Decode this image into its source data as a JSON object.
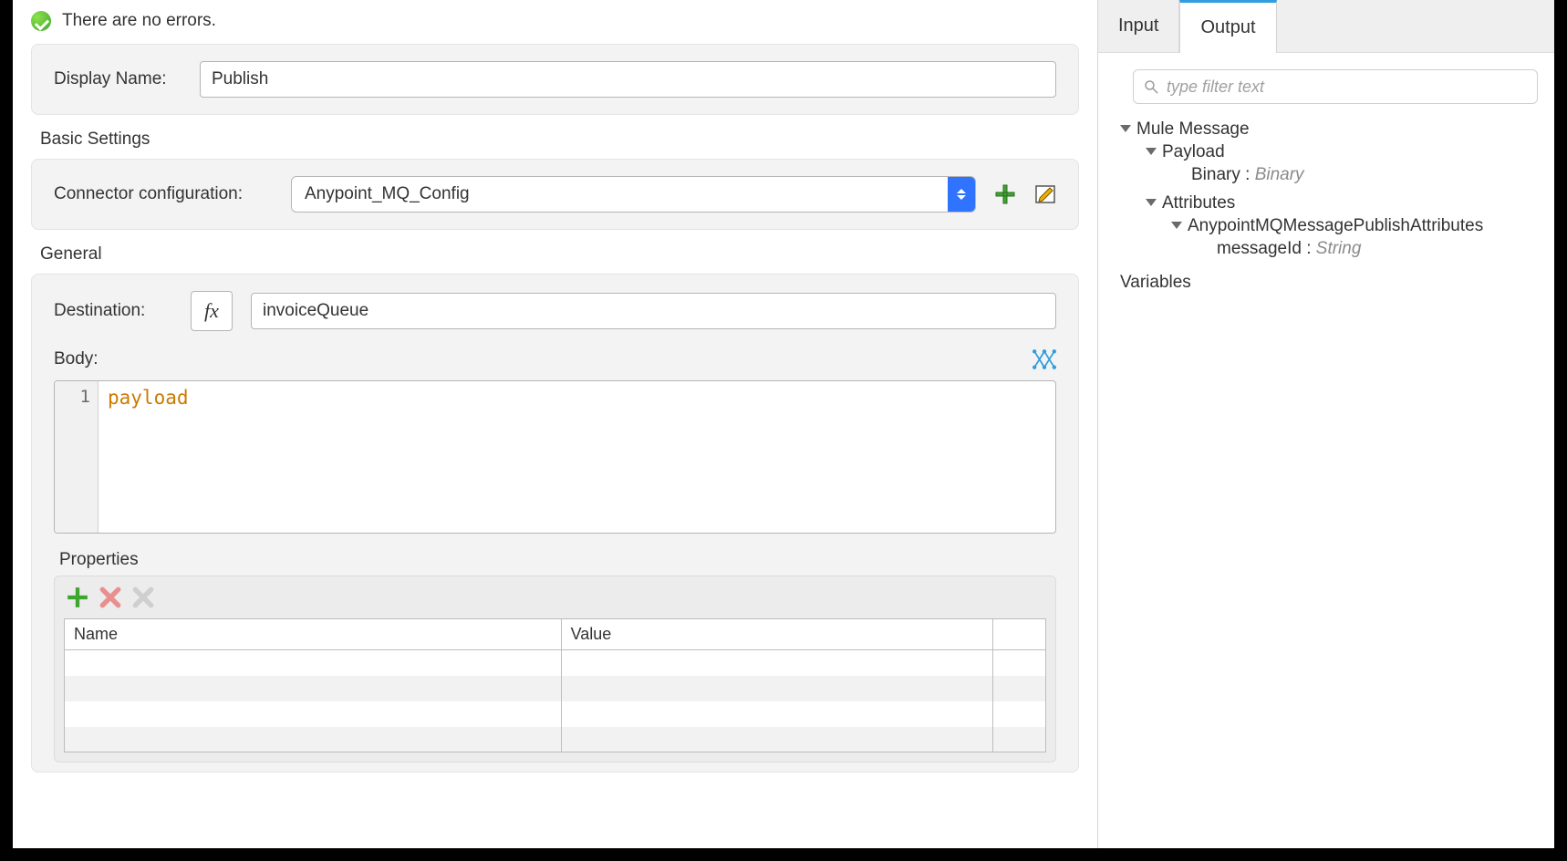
{
  "status": {
    "message": "There are no errors."
  },
  "display_name": {
    "label": "Display Name:",
    "value": "Publish"
  },
  "sections": {
    "basic": "Basic Settings",
    "general": "General"
  },
  "connector_config": {
    "label": "Connector configuration:",
    "value": "Anypoint_MQ_Config"
  },
  "destination": {
    "label": "Destination:",
    "value": "invoiceQueue",
    "fx": "fx"
  },
  "body": {
    "label": "Body:",
    "line_no": "1",
    "content": "payload"
  },
  "properties": {
    "label": "Properties",
    "col_name": "Name",
    "col_value": "Value",
    "rows": [
      "",
      "",
      "",
      ""
    ]
  },
  "right_panel": {
    "tabs": {
      "input": "Input",
      "output": "Output"
    },
    "filter_placeholder": "type filter text",
    "tree": {
      "mule_message": "Mule Message",
      "payload": "Payload",
      "binary_key": "Binary : ",
      "binary_type": "Binary",
      "attributes": "Attributes",
      "attr_class": "AnypointMQMessagePublishAttributes",
      "msg_id_key": "messageId : ",
      "msg_id_type": "String",
      "variables": "Variables"
    }
  }
}
